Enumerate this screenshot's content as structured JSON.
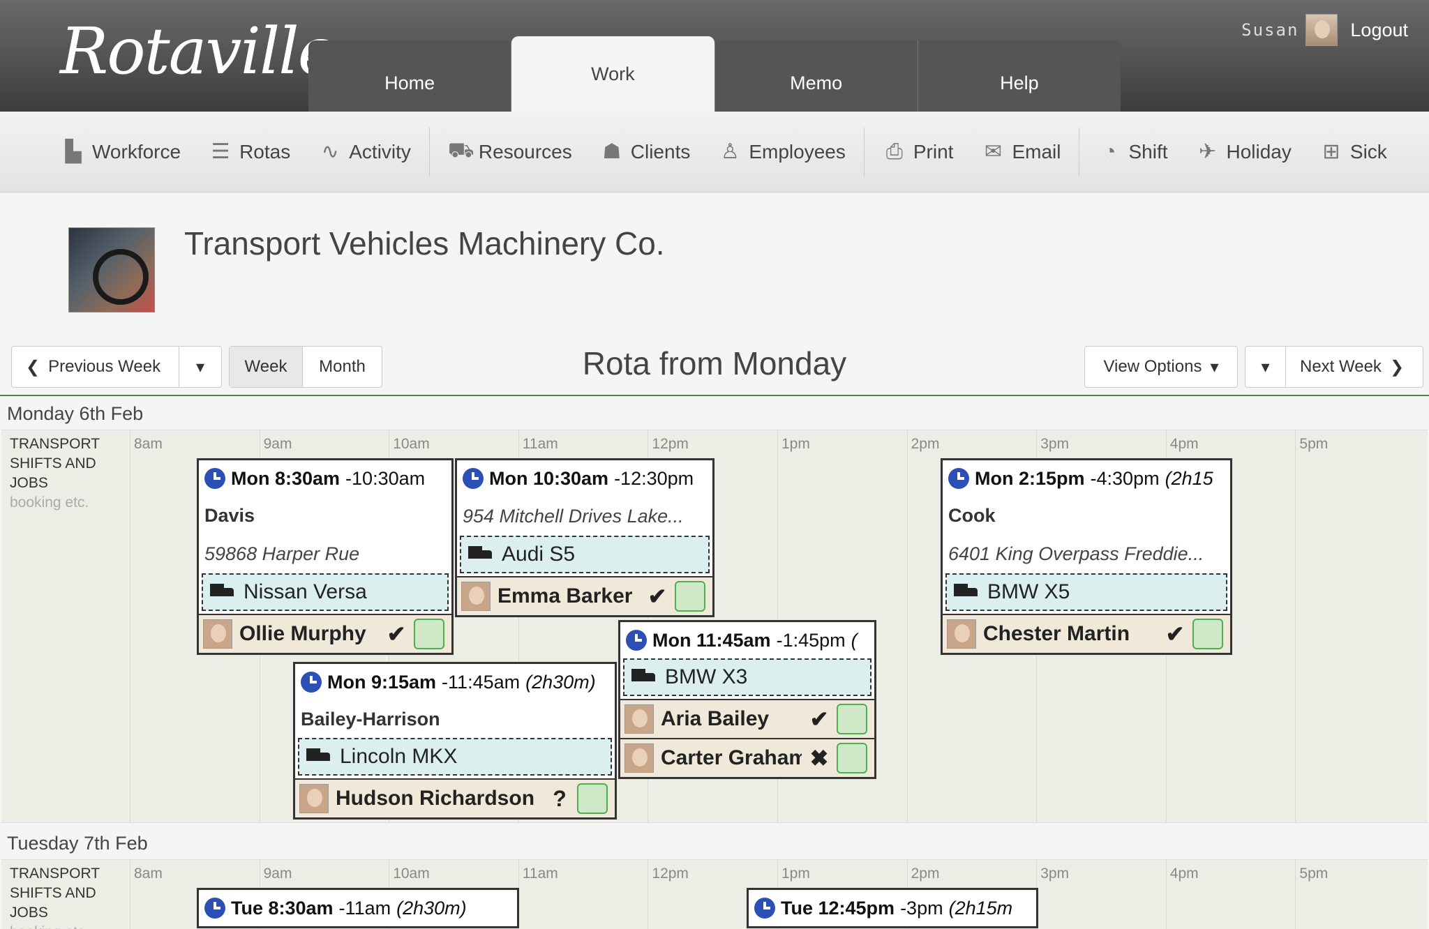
{
  "app": {
    "logo": "Rotaville",
    "user_name": "Susan",
    "logout": "Logout"
  },
  "tabs": [
    "Home",
    "Work",
    "Memo",
    "Help"
  ],
  "toolbar": {
    "workforce": "Workforce",
    "rotas": "Rotas",
    "activity": "Activity",
    "resources": "Resources",
    "clients": "Clients",
    "employees": "Employees",
    "print": "Print",
    "email": "Email",
    "shift": "Shift",
    "holiday": "Holiday",
    "sick": "Sick"
  },
  "company": {
    "name": "Transport Vehicles Machinery Co."
  },
  "nav": {
    "previous_week": "Previous Week",
    "week": "Week",
    "month": "Month",
    "title": "Rota from Monday",
    "view_options": "View Options",
    "next_week": "Next Week"
  },
  "hours": [
    "8am",
    "9am",
    "10am",
    "11am",
    "12pm",
    "1pm",
    "2pm",
    "3pm",
    "4pm",
    "5pm"
  ],
  "row_label": {
    "title_line1": "TRANSPORT",
    "title_line2": "SHIFTS AND",
    "title_line3": "JOBS",
    "sub": "booking etc."
  },
  "days": [
    {
      "title": "Monday 6th Feb",
      "shifts": [
        {
          "start": "Mon 8:30am",
          "end": "-10:30am",
          "duration": "",
          "client": "Davis",
          "address": "59868 Harper Rue",
          "vehicle": "Nissan Versa",
          "employees": [
            {
              "name": "Ollie Murphy",
              "status": "✔"
            }
          ]
        },
        {
          "start": "Mon 10:30am",
          "end": "-12:30pm",
          "duration": "",
          "client": "",
          "address": "954 Mitchell Drives Lake...",
          "vehicle": "Audi S5",
          "employees": [
            {
              "name": "Emma Barker",
              "status": "✔"
            }
          ]
        },
        {
          "start": "Mon 2:15pm",
          "end": "-4:30pm",
          "duration": "(2h15",
          "client": "Cook",
          "address": "6401 King Overpass Freddie...",
          "vehicle": "BMW X5",
          "employees": [
            {
              "name": "Chester Martin",
              "status": "✔"
            }
          ]
        },
        {
          "start": "Mon 11:45am",
          "end": "-1:45pm",
          "duration": "(",
          "client": "",
          "address": "",
          "vehicle": "BMW X3",
          "employees": [
            {
              "name": "Aria Bailey",
              "status": "✔"
            },
            {
              "name": "Carter Graham",
              "status": "✖"
            }
          ]
        },
        {
          "start": "Mon 9:15am",
          "end": "-11:45am",
          "duration": "(2h30m)",
          "client": "Bailey-Harrison",
          "address": "",
          "vehicle": "Lincoln MKX",
          "employees": [
            {
              "name": "Hudson Richardson",
              "status": "?"
            }
          ]
        }
      ]
    },
    {
      "title": "Tuesday 7th Feb",
      "shifts": [
        {
          "start": "Tue 8:30am",
          "end": "-11am",
          "duration": "(2h30m)"
        },
        {
          "start": "Tue 12:45pm",
          "end": "-3pm",
          "duration": "(2h15m"
        }
      ]
    }
  ]
}
